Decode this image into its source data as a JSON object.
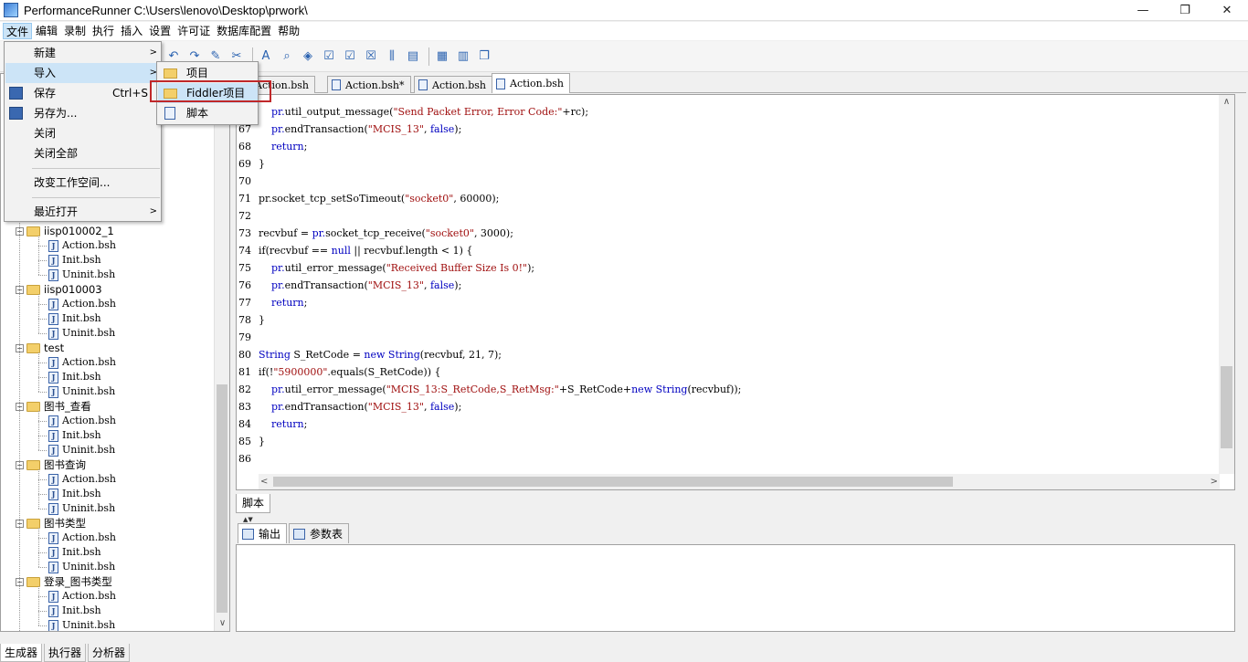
{
  "window": {
    "title": "PerformanceRunner  C:\\Users\\lenovo\\Desktop\\prwork\\",
    "minimize": "—",
    "maximize": "❐",
    "close": "✕"
  },
  "menubar": [
    "文件",
    "编辑",
    "录制",
    "执行",
    "插入",
    "设置",
    "许可证",
    "数据库配置",
    "帮助"
  ],
  "file_menu": {
    "new": "新建",
    "import": "导入",
    "save": "保存",
    "save_shortcut": "Ctrl+S",
    "save_as": "另存为...",
    "close": "关闭",
    "close_all": "关闭全部",
    "change_workspace": "改变工作空间...",
    "recent": "最近打开"
  },
  "import_submenu": {
    "project": "项目",
    "fiddler": "Fiddler项目",
    "script": "脚本"
  },
  "tree": {
    "projects": [
      {
        "name": "iisp010002_1",
        "files": [
          "Action.bsh",
          "Init.bsh",
          "Uninit.bsh"
        ]
      },
      {
        "name": "iisp010003",
        "files": [
          "Action.bsh",
          "Init.bsh",
          "Uninit.bsh"
        ]
      },
      {
        "name": "test",
        "files": [
          "Action.bsh",
          "Init.bsh",
          "Uninit.bsh"
        ]
      },
      {
        "name": "图书_查看",
        "files": [
          "Action.bsh",
          "Init.bsh",
          "Uninit.bsh"
        ]
      },
      {
        "name": "图书查询",
        "files": [
          "Action.bsh",
          "Init.bsh",
          "Uninit.bsh"
        ]
      },
      {
        "name": "图书类型",
        "files": [
          "Action.bsh",
          "Init.bsh",
          "Uninit.bsh"
        ]
      },
      {
        "name": "登录_图书类型",
        "files": [
          "Action.bsh",
          "Init.bsh",
          "Uninit.bsh"
        ]
      }
    ]
  },
  "editor_tabs": [
    "Action.bsh",
    "Action.bsh*",
    "Action.bsh",
    "Action.bsh"
  ],
  "code": [
    {
      "ln": "",
      "text": "    pr.util_output_message(\"Send Packet Error, Error Code:\"+rc);"
    },
    {
      "ln": "67",
      "text": "    pr.endTransaction(\"MCIS_13\", false);"
    },
    {
      "ln": "68",
      "text": "    return;"
    },
    {
      "ln": "69",
      "text": "}"
    },
    {
      "ln": "70",
      "text": ""
    },
    {
      "ln": "71",
      "text": "pr.socket_tcp_setSoTimeout(\"socket0\", 60000);"
    },
    {
      "ln": "72",
      "text": ""
    },
    {
      "ln": "73",
      "text": "recvbuf = pr.socket_tcp_receive(\"socket0\", 3000);"
    },
    {
      "ln": "74",
      "text": "if(recvbuf == null || recvbuf.length < 1) {"
    },
    {
      "ln": "75",
      "text": "    pr.util_error_message(\"Received Buffer Size Is 0!\");"
    },
    {
      "ln": "76",
      "text": "    pr.endTransaction(\"MCIS_13\", false);"
    },
    {
      "ln": "77",
      "text": "    return;"
    },
    {
      "ln": "78",
      "text": "}"
    },
    {
      "ln": "79",
      "text": ""
    },
    {
      "ln": "80",
      "text": "String S_RetCode = new String(recvbuf, 21, 7);"
    },
    {
      "ln": "81",
      "text": "if(!\"5900000\".equals(S_RetCode)) {"
    },
    {
      "ln": "82",
      "text": "    pr.util_error_message(\"MCIS_13:S_RetCode,S_RetMsg:\"+S_RetCode+new String(recvbuf));"
    },
    {
      "ln": "83",
      "text": "    pr.endTransaction(\"MCIS_13\", false);"
    },
    {
      "ln": "84",
      "text": "    return;"
    },
    {
      "ln": "85",
      "text": "}"
    },
    {
      "ln": "86",
      "text": ""
    }
  ],
  "script_tab": "脚本",
  "output_tabs": [
    "输出",
    "参数表"
  ],
  "bottom_tabs": [
    "生成器",
    "执行器",
    "分析器"
  ],
  "colors": {
    "highlight": "#cce4f7",
    "annotation_box": "#c0282a"
  }
}
